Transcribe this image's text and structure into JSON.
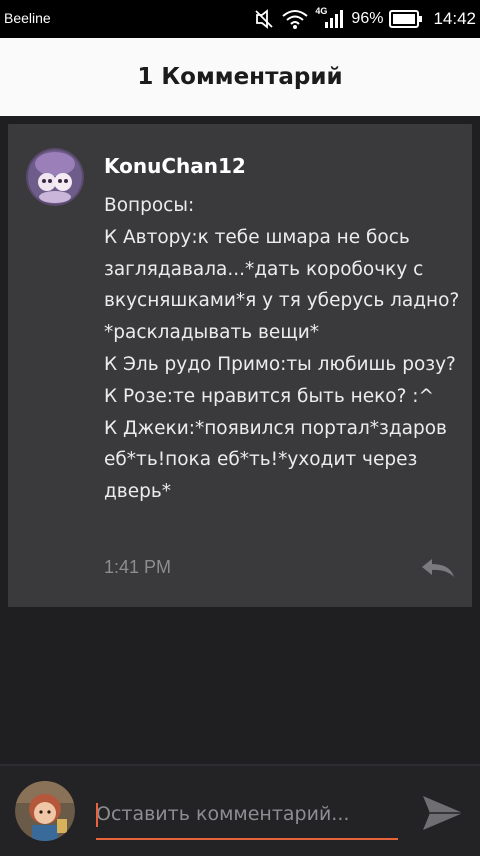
{
  "status_bar": {
    "carrier": "Beeline",
    "network_type": "4G",
    "battery_percent": "96%",
    "time": "14:42",
    "icons": [
      "mute-icon",
      "wifi-icon",
      "signal-icon",
      "battery-icon"
    ]
  },
  "header": {
    "title": "1 Комментарий"
  },
  "comment": {
    "author": "KonuChan12",
    "text": "Вопросы:\nК Автору:к тебе шмара не бось заглядавала...*дать коробочку с вкусняшками*я у тя уберусь ладно?*раскладывать вещи*\nК Эль рудо Примо:ты любишь розу?\nК Розе:те нравится быть неко? :^\nК Джеки:*появился портал*здаров еб*ть!пока еб*ть!*уходит через дверь*",
    "timestamp": "1:41 PM",
    "reply_icon": "reply-icon"
  },
  "composer": {
    "placeholder": "Оставить комментарий...",
    "value": "",
    "send_icon": "send-icon",
    "accent_color": "#e8643c"
  }
}
